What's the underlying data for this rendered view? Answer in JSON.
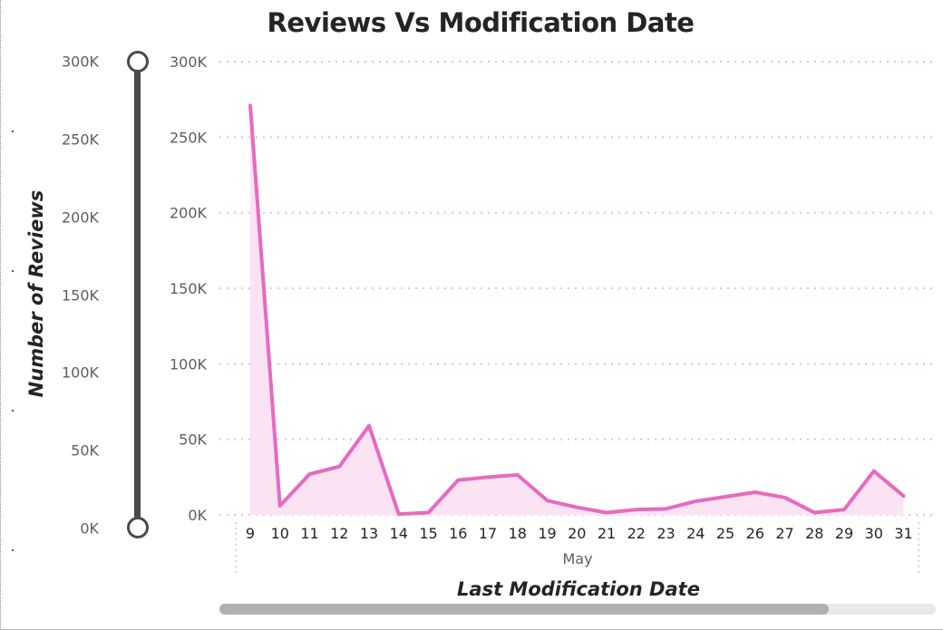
{
  "chart_data": {
    "type": "area",
    "title": "Reviews Vs Modification Date",
    "xlabel": "Last Modification Date",
    "ylabel": "Number of Reviews",
    "x_group_label": "May",
    "categories": [
      "9",
      "10",
      "11",
      "12",
      "13",
      "14",
      "15",
      "16",
      "17",
      "18",
      "19",
      "20",
      "21",
      "22",
      "23",
      "24",
      "25",
      "26",
      "27",
      "28",
      "29",
      "30",
      "31"
    ],
    "values": [
      271000,
      6000,
      27000,
      32000,
      59000,
      500,
      1500,
      23000,
      25000,
      26500,
      9500,
      5000,
      1500,
      3500,
      4000,
      9000,
      12000,
      15000,
      11500,
      1500,
      3500,
      29000,
      12500
    ],
    "ylim": [
      0,
      300000
    ],
    "y_ticks": [
      "0K",
      "50K",
      "100K",
      "150K",
      "200K",
      "250K",
      "300K"
    ],
    "grid": true,
    "line_color": "#e66ac0",
    "fill_color": "#fbe3f3",
    "grid_color": "#f2bcd9"
  },
  "slider": {
    "ticks": [
      "0K",
      "50K",
      "100K",
      "150K",
      "200K",
      "250K",
      "300K"
    ],
    "range": [
      0,
      300000
    ],
    "color": "#4a4a4a"
  },
  "scrollbar": {
    "thumb_fraction": 0.85
  }
}
